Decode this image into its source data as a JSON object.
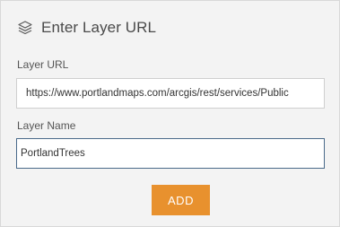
{
  "header": {
    "icon": "layers-icon",
    "title": "Enter Layer URL"
  },
  "form": {
    "url_label": "Layer URL",
    "url_value": "https://www.portlandmaps.com/arcgis/rest/services/Public",
    "name_label": "Layer Name",
    "name_value": "PortlandTrees"
  },
  "actions": {
    "add_label": "ADD"
  },
  "colors": {
    "accent": "#e8912e",
    "focus_border": "#4a6a8a",
    "panel_bg": "#f3f3f3"
  }
}
